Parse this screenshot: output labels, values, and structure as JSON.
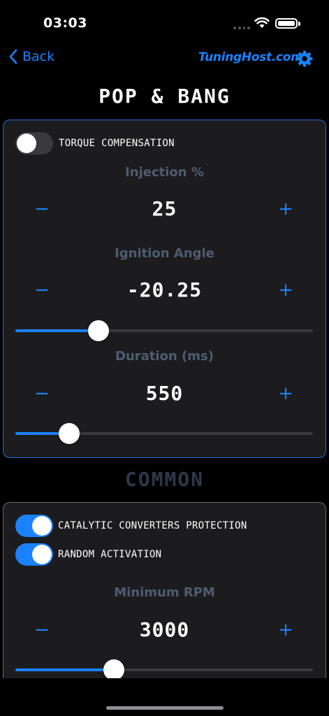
{
  "status_bar": {
    "time": "03:03",
    "battery_level": 1.0
  },
  "nav": {
    "back_label": "Back",
    "brand": "TuningHost.com"
  },
  "colors": {
    "accent": "#1a82ff",
    "background": "#000000",
    "card": "#1c1c1e",
    "label_muted": "#4f5c70"
  },
  "pop_bang": {
    "title": "POP & BANG",
    "torque_compensation": {
      "label": "TORQUE COMPENSATION",
      "on": false
    },
    "injection": {
      "label": "Injection %",
      "value": "25",
      "minus": "−",
      "plus": "+"
    },
    "ignition": {
      "label": "Ignition Angle",
      "value": "-20.25",
      "minus": "−",
      "plus": "+",
      "slider_fraction": 0.28
    },
    "duration": {
      "label": "Duration (ms)",
      "value": "550",
      "minus": "−",
      "plus": "+",
      "slider_fraction": 0.18
    }
  },
  "common": {
    "title": "COMMON",
    "catalytic": {
      "label": "CATALYTIC CONVERTERS PROTECTION",
      "on": true
    },
    "random": {
      "label": "RANDOM ACTIVATION",
      "on": true
    },
    "min_rpm": {
      "label": "Minimum RPM",
      "value": "3000",
      "minus": "−",
      "plus": "+",
      "slider_fraction": 0.33
    }
  }
}
